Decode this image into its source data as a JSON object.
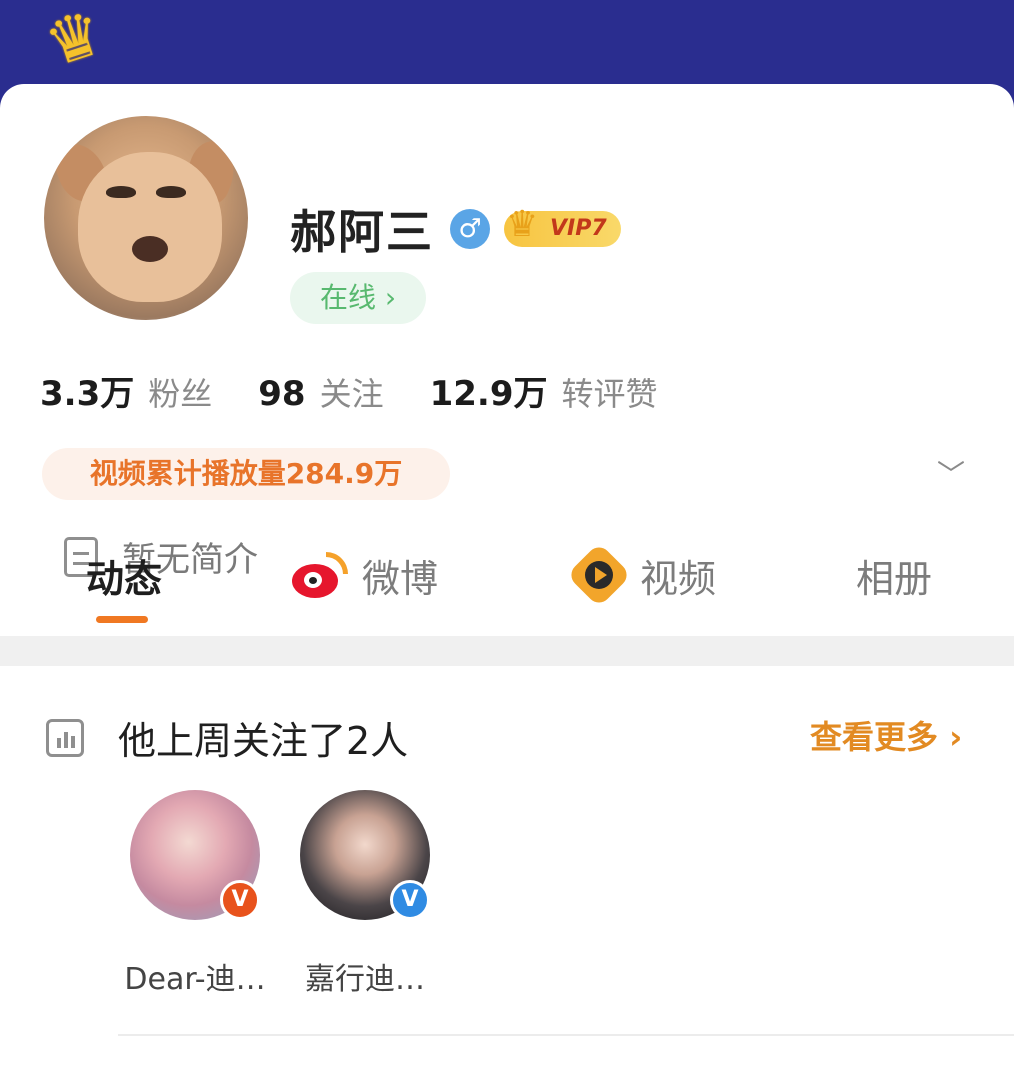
{
  "profile": {
    "username": "郝阿三",
    "gender_symbol": "♂",
    "vip_label": "VIP7",
    "status_pill": "在线 ›",
    "stats": [
      {
        "value": "3.3万",
        "label": "粉丝"
      },
      {
        "value": "98",
        "label": "关注"
      },
      {
        "value": "12.9万",
        "label": "转评赞"
      }
    ],
    "video_views": "视频累计播放量284.9万",
    "bio": "暂无简介"
  },
  "tabs": [
    {
      "label": "动态",
      "active": true
    },
    {
      "label": "微博",
      "icon": "weibo-icon"
    },
    {
      "label": "视频",
      "icon": "video-icon"
    },
    {
      "label": "相册"
    }
  ],
  "follow_section": {
    "title": "他上周关注了2人",
    "see_more": "查看更多 ›",
    "friends": [
      {
        "name": "Dear-迪…",
        "badge": "V",
        "badge_color": "#e8521c"
      },
      {
        "name": "嘉行迪…",
        "badge": "V",
        "badge_color": "#2f8be3"
      }
    ]
  },
  "colors": {
    "header_bg": "#2a2d8f",
    "accent_orange": "#f07822",
    "online_green": "#58b96f"
  }
}
